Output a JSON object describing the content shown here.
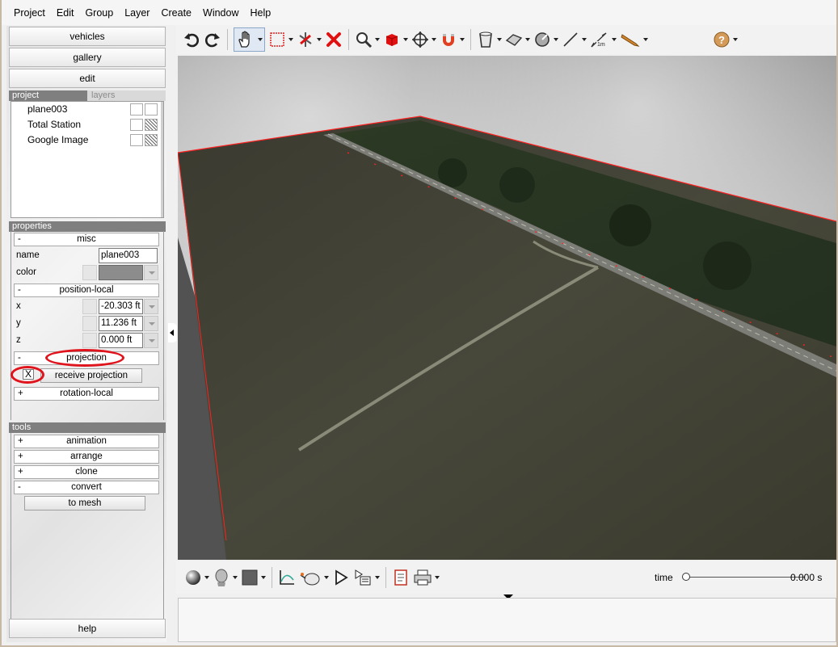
{
  "menu": {
    "items": [
      "Project",
      "Edit",
      "Group",
      "Layer",
      "Create",
      "Window",
      "Help"
    ]
  },
  "left_panel": {
    "vehicles_label": "vehicles",
    "gallery_label": "gallery",
    "edit_label": "edit",
    "help_label": "help",
    "tabs": {
      "project": "project",
      "layers": "layers"
    },
    "scene_items": [
      "plane003",
      "Total Station",
      "Google Image"
    ],
    "properties_header": "properties",
    "groups": {
      "misc": {
        "sign": "-",
        "label": "misc"
      },
      "position_local": {
        "sign": "-",
        "label": "position-local"
      },
      "projection": {
        "sign": "-",
        "label": "projection"
      },
      "rotation_local": {
        "sign": "+",
        "label": "rotation-local"
      }
    },
    "props": {
      "name_label": "name",
      "name_value": "plane003",
      "color_label": "color",
      "x_label": "x",
      "x_value": "-20.303 ft",
      "y_label": "y",
      "y_value": "11.236 ft",
      "z_label": "z",
      "z_value": "0.000 ft",
      "receive_projection_check": "X",
      "receive_projection_label": "receive projection"
    },
    "tools_header": "tools",
    "tools": {
      "animation": {
        "sign": "+",
        "label": "animation"
      },
      "arrange": {
        "sign": "+",
        "label": "arrange"
      },
      "clone": {
        "sign": "+",
        "label": "clone"
      },
      "convert": {
        "sign": "-",
        "label": "convert"
      },
      "to_mesh": "to mesh"
    }
  },
  "timeline": {
    "label": "time",
    "value": "0.000 s",
    "position": 0
  },
  "colors": {
    "annotation_red": "#e0141c",
    "selection_red": "#ff2020",
    "header_gray": "#7f7f7f"
  }
}
